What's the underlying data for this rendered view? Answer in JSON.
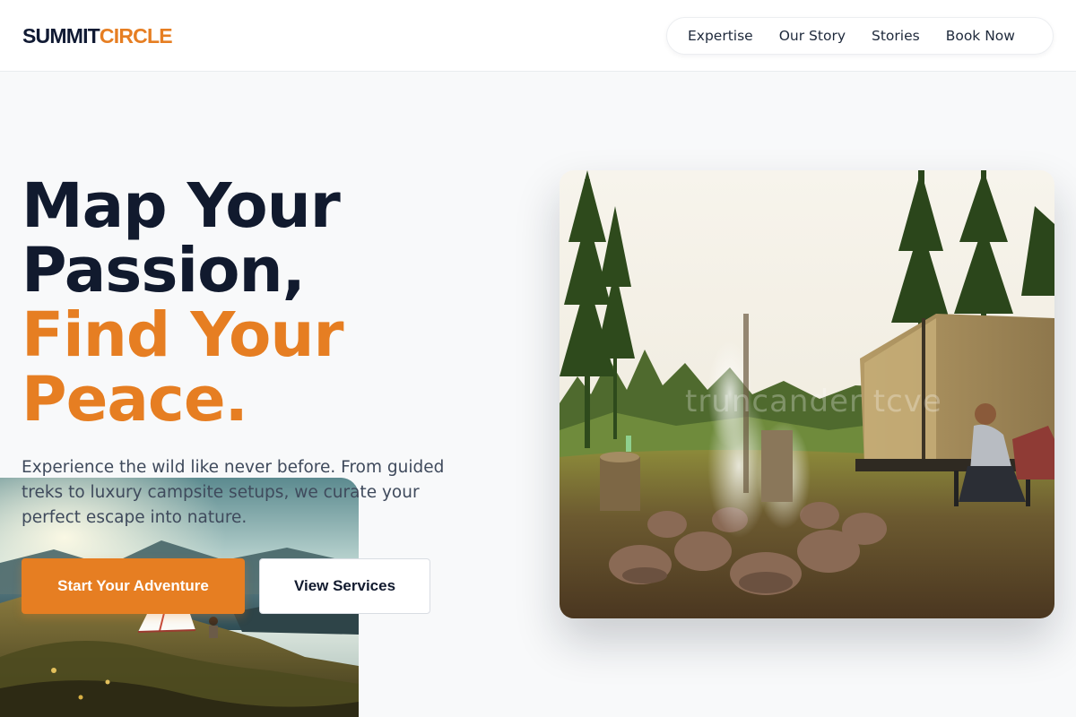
{
  "brand": {
    "part1": "SUMMIT",
    "part2": "CIRCLE"
  },
  "nav": {
    "items": [
      "Expertise",
      "Our Story",
      "Stories",
      "Book Now"
    ]
  },
  "hero": {
    "headline_line1": "Map Your",
    "headline_line2": "Passion,",
    "headline_line3": "Find Your",
    "headline_line4": "Peace.",
    "description": "Experience the wild like never before. From guided treks to luxury campsite setups, we curate your perfect escape into nature.",
    "primary_cta": "Start Your Adventure",
    "secondary_cta": "View Services"
  },
  "images": {
    "hero_photo": "campfire-campsite-photo",
    "secondary_photo": "mountain-tent-photo",
    "watermark_text": "truncander tcve"
  },
  "colors": {
    "accent": "#e67e22",
    "heading": "#111a2e",
    "body_text": "#3f4a5c",
    "background": "#f8f9fa"
  }
}
